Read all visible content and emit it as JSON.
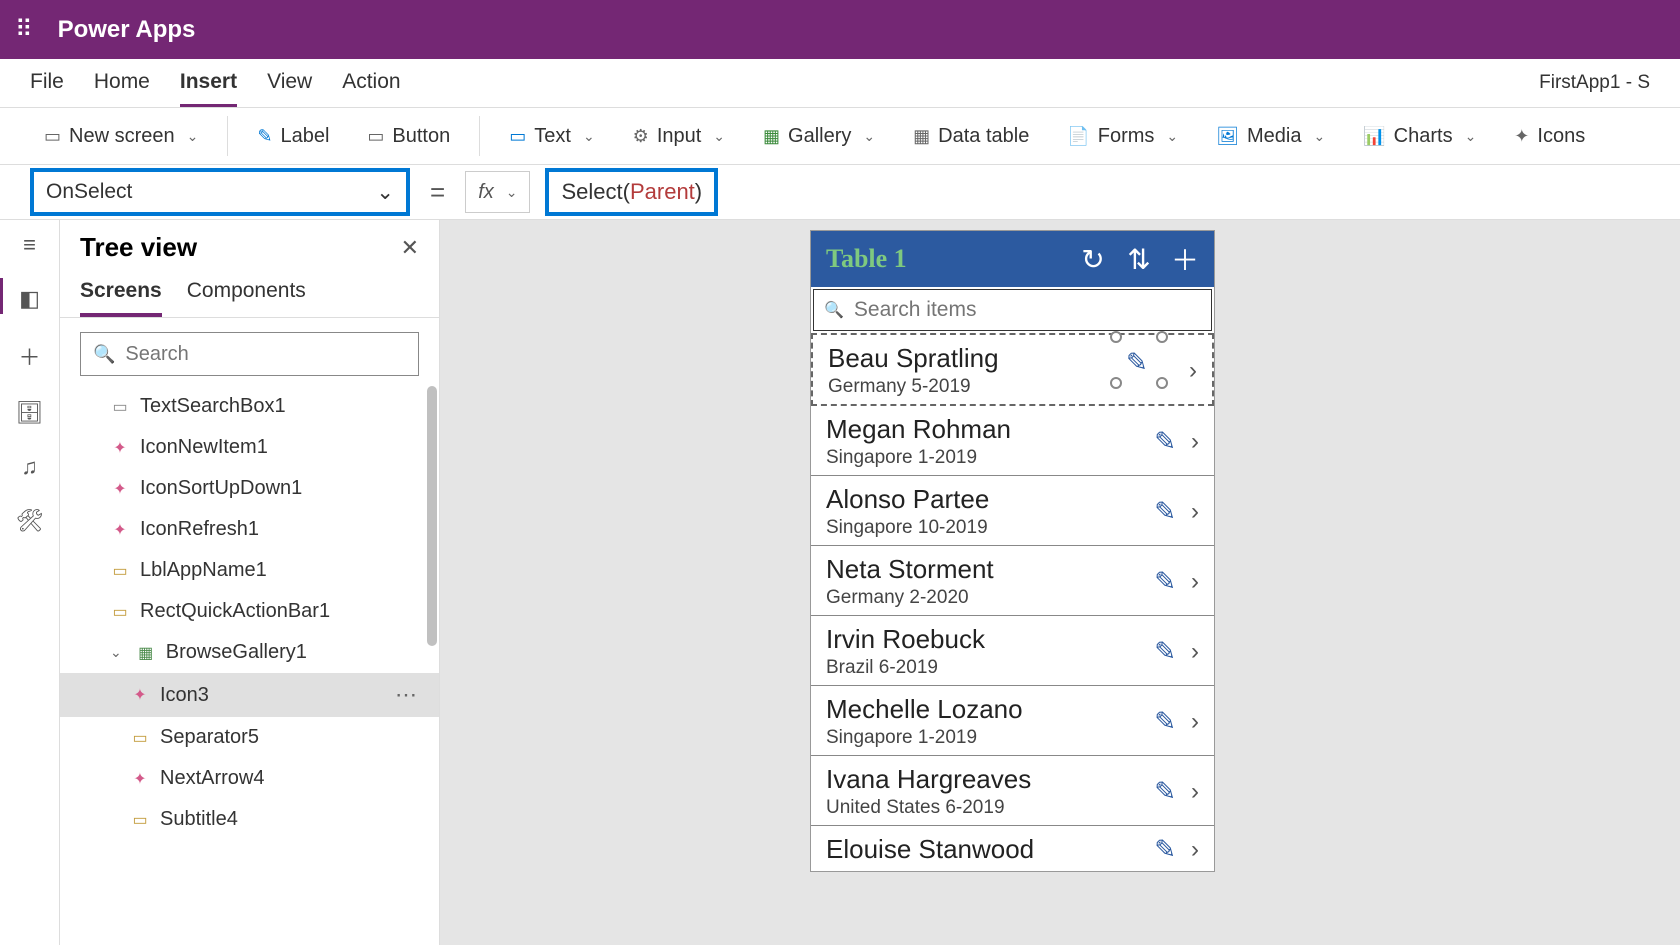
{
  "header": {
    "app_title": "Power Apps"
  },
  "menubar": {
    "items": [
      "File",
      "Home",
      "Insert",
      "View",
      "Action"
    ],
    "app_name": "FirstApp1 - S"
  },
  "ribbon": {
    "new_screen": "New screen",
    "label": "Label",
    "button": "Button",
    "text": "Text",
    "input": "Input",
    "gallery": "Gallery",
    "data_table": "Data table",
    "forms": "Forms",
    "media": "Media",
    "charts": "Charts",
    "icons": "Icons"
  },
  "formula": {
    "property": "OnSelect",
    "fx": "fx",
    "fn": "Select",
    "arg": "Parent"
  },
  "tree": {
    "title": "Tree view",
    "tabs": [
      "Screens",
      "Components"
    ],
    "search_placeholder": "Search",
    "items": [
      {
        "label": "TextSearchBox1",
        "icon": "text",
        "indent": 1
      },
      {
        "label": "IconNewItem1",
        "icon": "ctrl",
        "indent": 1
      },
      {
        "label": "IconSortUpDown1",
        "icon": "ctrl",
        "indent": 1
      },
      {
        "label": "IconRefresh1",
        "icon": "ctrl",
        "indent": 1
      },
      {
        "label": "LblAppName1",
        "icon": "lbl",
        "indent": 1
      },
      {
        "label": "RectQuickActionBar1",
        "icon": "rect",
        "indent": 1
      },
      {
        "label": "BrowseGallery1",
        "icon": "gallery",
        "indent": 1,
        "expandable": true
      },
      {
        "label": "Icon3",
        "icon": "ctrl",
        "indent": 2,
        "selected": true
      },
      {
        "label": "Separator5",
        "icon": "rect",
        "indent": 2
      },
      {
        "label": "NextArrow4",
        "icon": "ctrl",
        "indent": 2
      },
      {
        "label": "Subtitle4",
        "icon": "lbl",
        "indent": 2
      }
    ]
  },
  "phone": {
    "title": "Table 1",
    "search_placeholder": "Search items",
    "items": [
      {
        "title": "Beau Spratling",
        "sub": "Germany 5-2019"
      },
      {
        "title": "Megan Rohman",
        "sub": "Singapore 1-2019"
      },
      {
        "title": "Alonso Partee",
        "sub": "Singapore 10-2019"
      },
      {
        "title": "Neta Storment",
        "sub": "Germany 2-2020"
      },
      {
        "title": "Irvin Roebuck",
        "sub": "Brazil 6-2019"
      },
      {
        "title": "Mechelle Lozano",
        "sub": "Singapore 1-2019"
      },
      {
        "title": "Ivana Hargreaves",
        "sub": "United States 6-2019"
      },
      {
        "title": "Elouise Stanwood",
        "sub": ""
      }
    ]
  }
}
